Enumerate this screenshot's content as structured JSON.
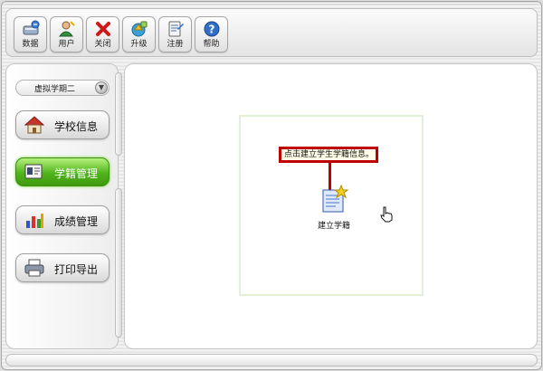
{
  "toolbar": {
    "buttons": [
      {
        "label": "数据",
        "icon": "database-icon"
      },
      {
        "label": "用户",
        "icon": "user-icon"
      },
      {
        "label": "关闭",
        "icon": "close-icon"
      },
      {
        "label": "升级",
        "icon": "upgrade-icon"
      },
      {
        "label": "注册",
        "icon": "register-icon"
      },
      {
        "label": "帮助",
        "icon": "help-icon"
      }
    ]
  },
  "sidebar": {
    "term_select": "虚拟学期二",
    "items": [
      {
        "label": "学校信息",
        "icon": "school-house-icon",
        "active": false
      },
      {
        "label": "学籍管理",
        "icon": "student-card-icon",
        "active": true
      },
      {
        "label": "成绩管理",
        "icon": "bar-chart-icon",
        "active": false
      },
      {
        "label": "打印导出",
        "icon": "printer-icon",
        "active": false
      }
    ]
  },
  "main": {
    "tooltip": "点击建立学生学籍信息。",
    "create_button_label": "建立学籍"
  },
  "colors": {
    "active_nav": "#4fb41a",
    "tooltip_border": "#c00000",
    "close_red": "#d01818"
  }
}
